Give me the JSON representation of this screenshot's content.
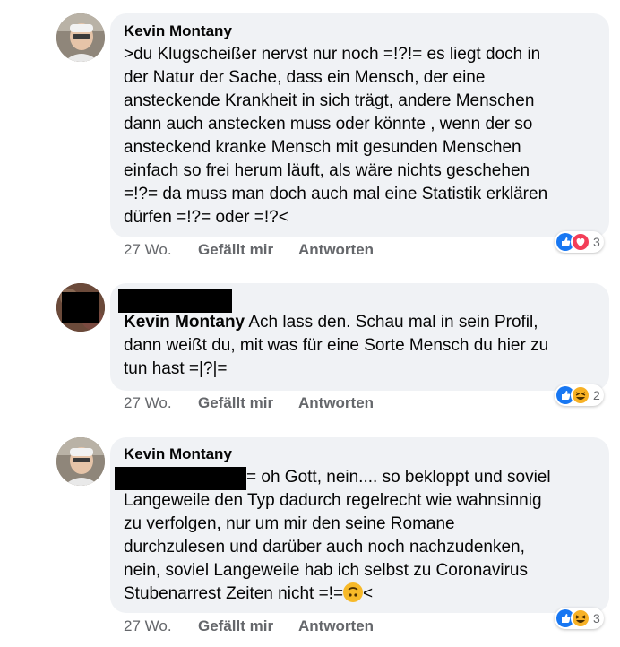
{
  "comments": [
    {
      "author": "Kevin Montany",
      "lines": [
        ">du Klugscheißer nervst nur noch =!?!= es liegt doch in",
        "der Natur der Sache, dass ein Mensch, der eine",
        "ansteckende  Krankheit in sich trägt, andere Menschen",
        "dann  auch anstecken muss oder könnte , wenn der so",
        "ansteckend kranke Mensch mit gesunden Menschen",
        "einfach so frei herum läuft, als wäre nichts geschehen",
        "=!?= da muss man doch auch mal eine Statistik erklären",
        "dürfen =!?= oder =!?<"
      ],
      "time": "27 Wo.",
      "like_label": "Gefällt mir",
      "reply_label": "Antworten",
      "reactions": [
        "like-icon",
        "love-icon"
      ],
      "reaction_count": "3"
    },
    {
      "tag": "Kevin Montany",
      "lines": [
        " Ach lass den. Schau mal in sein Profil,",
        "dann weißt du, mit was für eine Sorte Mensch du hier zu",
        "tun hast =|?|="
      ],
      "time": "27 Wo.",
      "like_label": "Gefällt mir",
      "reply_label": "Antworten",
      "reactions": [
        "like-icon",
        "haha-icon"
      ],
      "reaction_count": "2"
    },
    {
      "author": "Kevin Montany",
      "lines": [
        "= oh Gott, nein.... so bekloppt und soviel",
        "Langeweile den Typ dadurch regelrecht wie wahnsinnig",
        "zu verfolgen, nur um mir den seine Romane",
        "durchzulesen und darüber auch noch nachzudenken,",
        "nein,  soviel Langeweile hab ich selbst zu Coronavirus",
        "Stubenarrest Zeiten nicht =!="
      ],
      "line_end": "<",
      "inline_emoji": "upside-down-face-icon",
      "time": "27 Wo.",
      "like_label": "Gefällt mir",
      "reply_label": "Antworten",
      "reactions": [
        "like-icon",
        "haha-icon"
      ],
      "reaction_count": "3"
    }
  ],
  "colors": {
    "like": "#1877f2",
    "love": "#f33e58",
    "haha": "#f7b125",
    "bubble": "#f0f2f5",
    "meta": "#65676b"
  }
}
